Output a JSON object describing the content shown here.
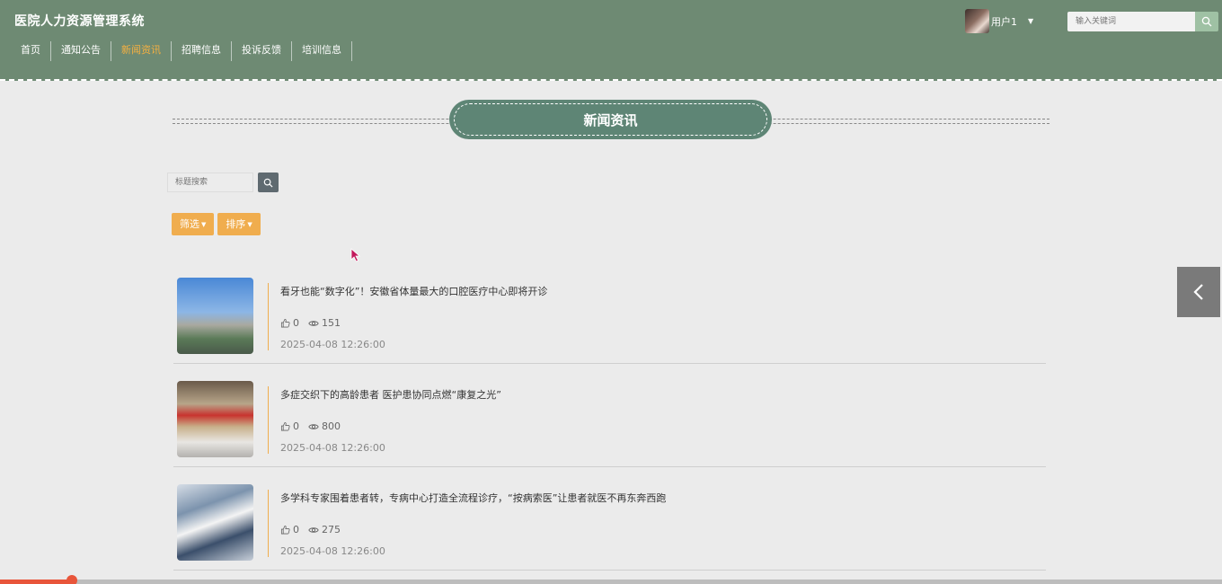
{
  "header": {
    "brand": "医院人力资源管理系统",
    "nav": [
      {
        "label": "首页",
        "active": false
      },
      {
        "label": "通知公告",
        "active": false
      },
      {
        "label": "新闻资讯",
        "active": true
      },
      {
        "label": "招聘信息",
        "active": false
      },
      {
        "label": "投诉反馈",
        "active": false
      },
      {
        "label": "培训信息",
        "active": false
      }
    ],
    "username": "用户1",
    "search_placeholder": "输入关键词",
    "colors": {
      "bg": "#6e8a73",
      "active_nav": "#f5b041"
    }
  },
  "section": {
    "title": "新闻资讯"
  },
  "search": {
    "placeholder": "标题搜索"
  },
  "filters": {
    "filter_label": "筛选",
    "sort_label": "排序"
  },
  "news": [
    {
      "title": "看牙也能“数字化”！安徽省体量最大的口腔医疗中心即将开诊",
      "likes": "0",
      "views": "151",
      "date": "2025-04-08 12:26:00"
    },
    {
      "title": "多症交织下的高龄患者 医护患协同点燃“康复之光”",
      "likes": "0",
      "views": "800",
      "date": "2025-04-08 12:26:00"
    },
    {
      "title": "多学科专家围着患者转，专病中心打造全流程诊疗，“按病索医”让患者就医不再东奔西跑",
      "likes": "0",
      "views": "275",
      "date": "2025-04-08 12:26:00"
    }
  ],
  "icons": {
    "search": "search-icon",
    "like": "thumbs-up-icon",
    "view": "eye-icon",
    "back": "chevron-left-icon"
  }
}
